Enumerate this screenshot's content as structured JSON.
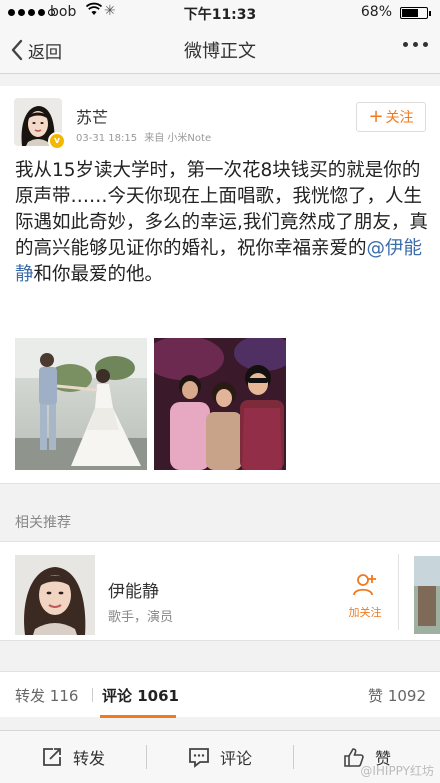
{
  "status_bar": {
    "carrier": "bob",
    "time": "下午11:33",
    "battery": "68%",
    "battery_level": 0.68
  },
  "nav": {
    "back_label": "返回",
    "title": "微博正文"
  },
  "post": {
    "username": "苏芒",
    "verified_badge": "v",
    "date": "03-31 18:15",
    "source": "来自 小米Note",
    "follow_label": "关注",
    "text": "我从15岁读大学时，第一次花8块钱买的就是你的原声带……今天你现在上面唱歌，我恍惚了，人生际遇如此奇妙，多么的幸运,我们竟然成了朋友，真的高兴能够见证你的婚礼，祝你幸福亲爱的",
    "mention": "@伊能静",
    "text_tail": "和你最爱的他。",
    "images": [
      "wedding-photo",
      "party-photo"
    ]
  },
  "related": {
    "section_label": "相关推荐",
    "name": "伊能静",
    "description": "歌手，演员",
    "follow_label": "加关注"
  },
  "stats": {
    "repost_label": "转发",
    "repost_count": "116",
    "comment_label": "评论",
    "comment_count": "1061",
    "like_label": "赞",
    "like_count": "1092"
  },
  "toolbar": {
    "repost": "转发",
    "comment": "评论",
    "like": "赞"
  },
  "watermark": "@IHIPPY红坊"
}
